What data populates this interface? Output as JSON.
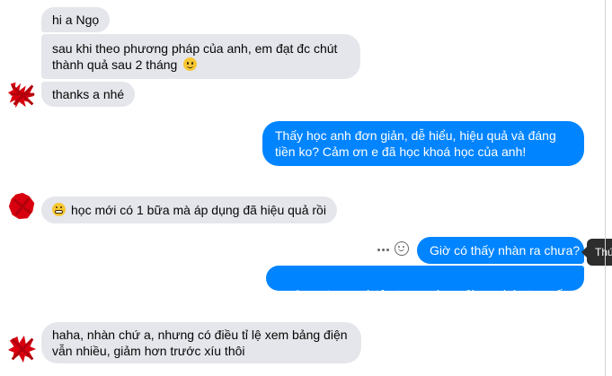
{
  "chat": {
    "messages": [
      {
        "text": "hi a Ngọ"
      },
      {
        "line1": "sau khi theo phương pháp của anh, em đạt đc chút",
        "line2": "thành quả sau 2 tháng"
      },
      {
        "text": "thanks a nhé"
      },
      {
        "line1": "Thấy học anh đơn giản, dễ hiểu, hiệu quả và đáng",
        "line2": "tiền ko? Cảm ơn e đã học khoá học của anh!"
      },
      {
        "text": "học mới có 1 bữa mà áp dụng đã hiệu quả rồi"
      },
      {
        "text": "Giờ có thấy nhàn ra chưa?"
      },
      {
        "text": "Quan trọng và tập trung vào    đừng phức tạp vấn đề"
      },
      {
        "line1": "haha, nhàn chứ a, nhưng có điều tỉ lệ xem bảng điện",
        "line2": "vẫn nhiều, giảm hơn trước xíu thôi"
      }
    ],
    "hover": {
      "more_icon": "more-horizontal-icon",
      "react_icon": "smile-react-icon",
      "tooltip_label": "Thứ"
    }
  },
  "colors": {
    "incoming_bubble": "#e4e6eb",
    "outgoing_bubble": "#0084ff",
    "avatar_scribble": "#d8000f"
  }
}
